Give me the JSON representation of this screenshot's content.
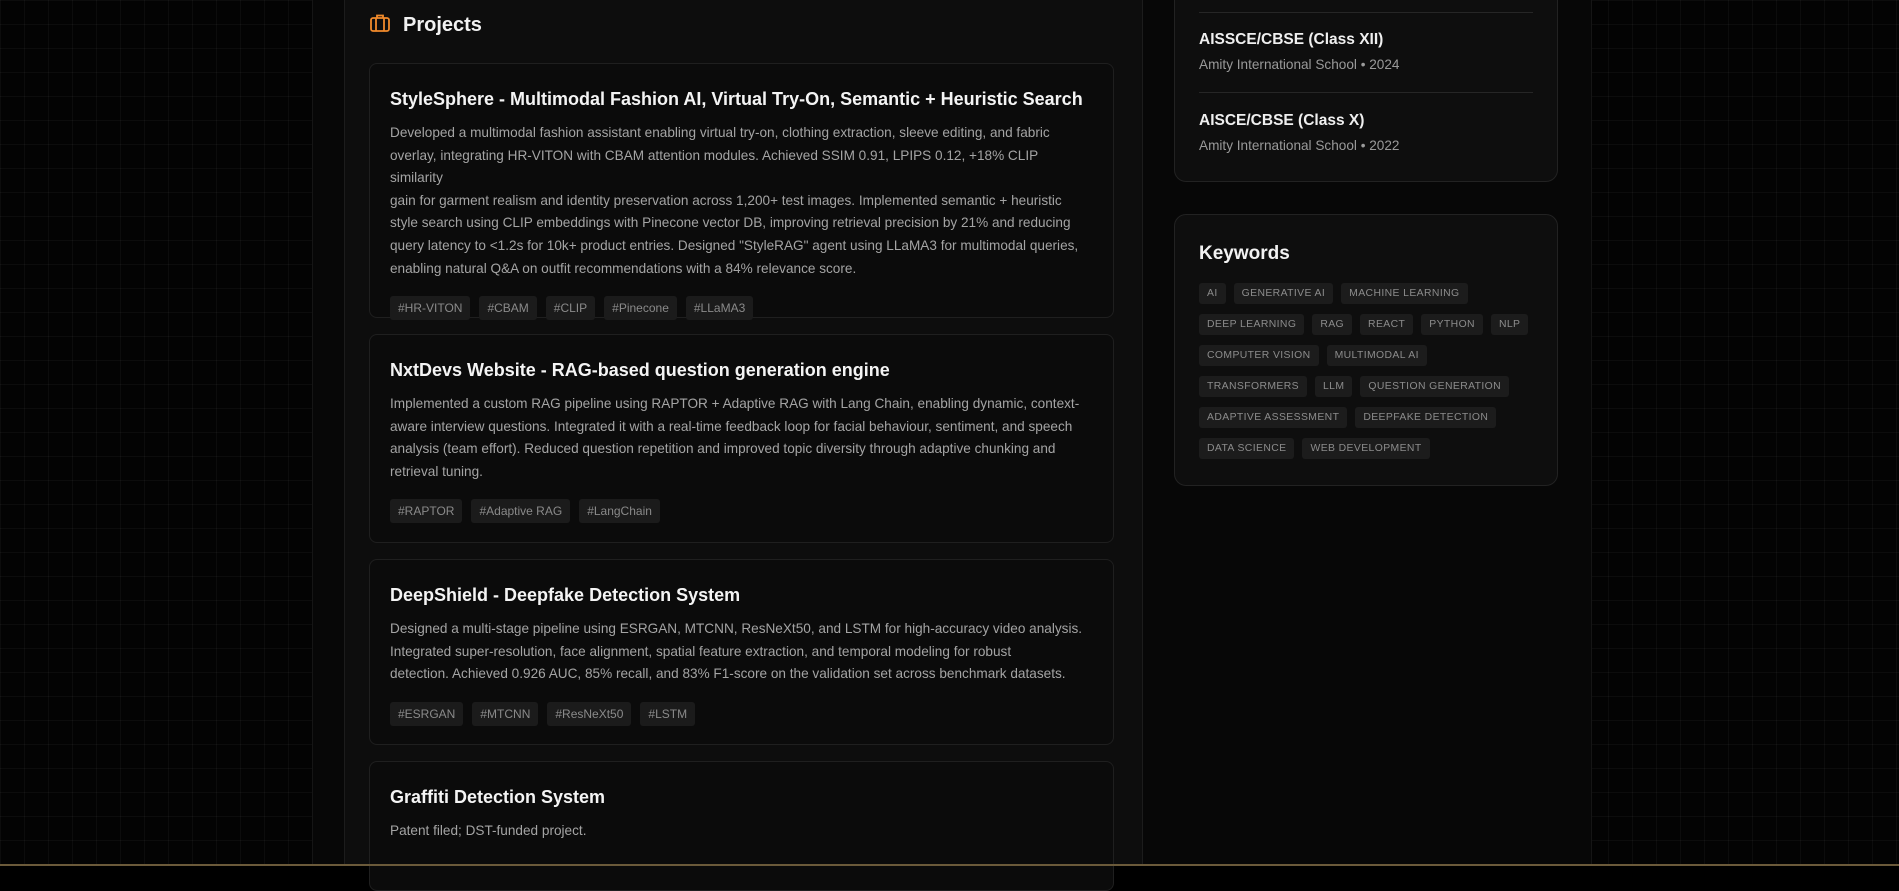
{
  "projects": {
    "title": "Projects",
    "icon": "briefcase-icon",
    "accent": "#f08a2b",
    "items": [
      {
        "title": "StyleSphere - Multimodal Fashion AI, Virtual Try-On, Semantic + Heuristic Search",
        "description_lines": [
          "Developed a multimodal fashion assistant enabling virtual try-on, clothing extraction, sleeve editing, and fabric",
          "overlay, integrating HR-VITON with CBAM attention modules. Achieved SSIM 0.91, LPIPS 0.12, +18% CLIP similarity",
          "gain for garment realism and identity preservation across 1,200+ test images. Implemented semantic + heuristic",
          "style search using CLIP embeddings with Pinecone vector DB, improving retrieval precision by 21% and reducing",
          "query latency to <1.2s for 10k+ product entries. Designed \"StyleRAG\" agent using LLaMA3 for multimodal queries,",
          "enabling natural Q&A on outfit recommendations with a 84% relevance score."
        ],
        "tags": [
          "#HR-VITON",
          "#CBAM",
          "#CLIP",
          "#Pinecone",
          "#LLaMA3"
        ]
      },
      {
        "title": "NxtDevs Website - RAG-based question generation engine",
        "description_lines": [
          "Implemented a custom RAG pipeline using RAPTOR + Adaptive RAG with Lang Chain, enabling dynamic, context-",
          "aware interview questions. Integrated it with a real-time feedback loop for facial behaviour, sentiment, and speech",
          "analysis (team effort). Reduced question repetition and improved topic diversity through adaptive chunking and",
          "retrieval tuning."
        ],
        "tags": [
          "#RAPTOR",
          "#Adaptive RAG",
          "#LangChain"
        ]
      },
      {
        "title": "DeepShield - Deepfake Detection System",
        "description_lines": [
          "Designed a multi-stage pipeline using ESRGAN, MTCNN, ResNeXt50, and LSTM for high-accuracy video analysis.",
          "Integrated super-resolution, face alignment, spatial feature extraction, and temporal modeling for robust",
          "detection. Achieved 0.926 AUC, 85% recall, and 83% F1-score on the validation set across benchmark datasets."
        ],
        "tags": [
          "#ESRGAN",
          "#MTCNN",
          "#ResNeXt50",
          "#LSTM"
        ]
      },
      {
        "title": "Graffiti Detection System",
        "description_lines": [
          "Patent filed; DST-funded project."
        ],
        "tags": []
      }
    ]
  },
  "education": {
    "items": [
      {
        "title": "AISSCE/CBSE (Class XII)",
        "subtitle": "Amity International School • 2024"
      },
      {
        "title": "AISCE/CBSE (Class X)",
        "subtitle": "Amity International School • 2022"
      }
    ]
  },
  "keywords": {
    "title": "Keywords",
    "items": [
      "AI",
      "GENERATIVE AI",
      "MACHINE LEARNING",
      "DEEP LEARNING",
      "RAG",
      "REACT",
      "PYTHON",
      "NLP",
      "COMPUTER VISION",
      "MULTIMODAL AI",
      "TRANSFORMERS",
      "LLM",
      "QUESTION GENERATION",
      "ADAPTIVE ASSESSMENT",
      "DEEPFAKE DETECTION",
      "DATA SCIENCE",
      "WEB DEVELOPMENT"
    ]
  }
}
